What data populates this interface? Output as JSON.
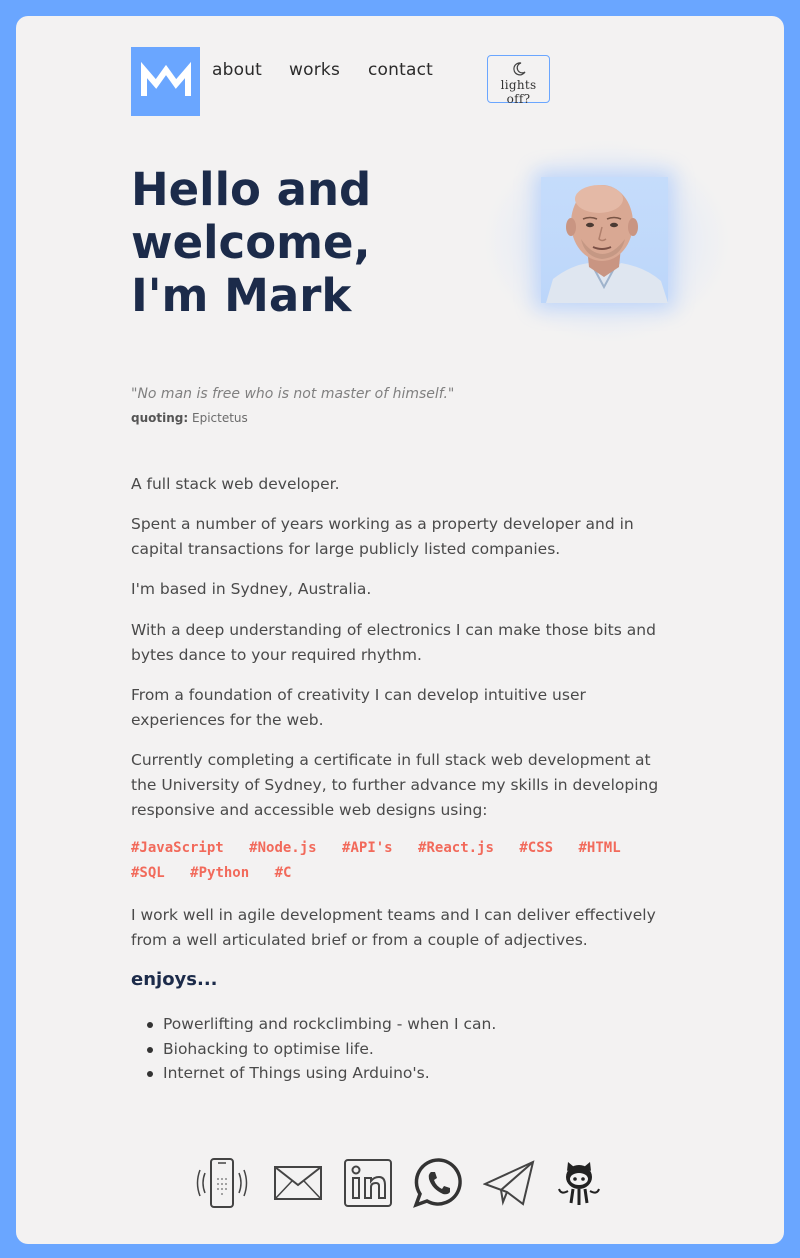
{
  "brand": {
    "logo_icon": "mw-monogram-logo",
    "accent": "#6aa6ff"
  },
  "nav": {
    "about": "about",
    "works": "works",
    "contact": "contact"
  },
  "theme_toggle": {
    "icon": "moon-icon",
    "label": "lights off?"
  },
  "hero": {
    "line1": "Hello and",
    "line2": "welcome,",
    "line3": "I'm Mark",
    "title_color": "#1c2b4a",
    "photo": "profile-photo"
  },
  "quote": {
    "text": "\"No man is free who is not master of himself.\"",
    "label": "quoting:",
    "author": "Epictetus"
  },
  "about": {
    "p1": "A full stack web developer.",
    "p2": "Spent a number of years working as a property developer and in capital transactions for large publicly listed companies.",
    "p3": "I'm based in Sydney, Australia.",
    "p4": "With a deep understanding of electronics I can make those bits and bytes dance to your required rhythm.",
    "p5": "From a foundation of creativity I can develop intuitive user experiences for the web.",
    "p6": "Currently completing a certificate in full stack web development at the University of Sydney, to further advance my skills in developing responsive and accessible web designs using:",
    "tags": [
      "#JavaScript",
      "#Node.js",
      "#API's",
      "#React.js",
      "#CSS",
      "#HTML",
      "#SQL",
      "#Python",
      "#C"
    ],
    "tag_color": "#f26a5b",
    "p7": "I work well in agile development teams and I can deliver effectively from a well articulated brief or from a couple of adjectives."
  },
  "enjoys": {
    "heading": "enjoys...",
    "items": [
      "Powerlifting and rockclimbing - when I can.",
      "Biohacking to optimise life.",
      "Internet of Things using Arduino's."
    ]
  },
  "social": [
    "phone-icon",
    "email-icon",
    "linkedin-icon",
    "whatsapp-icon",
    "telegram-icon",
    "github-icon"
  ]
}
